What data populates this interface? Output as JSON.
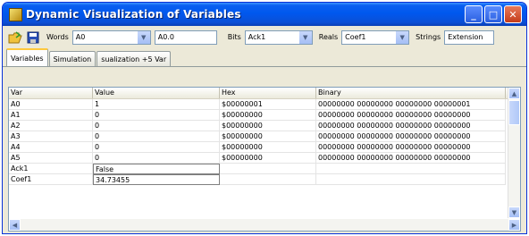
{
  "window": {
    "title": "Dynamic Visualization of Variables"
  },
  "toolbar": {
    "words_label": "Words",
    "words_value": "A0",
    "words_field": "A0.0",
    "bits_label": "Bits",
    "bits_value": "Ack1",
    "reals_label": "Reals",
    "reals_value": "Coef1",
    "strings_label": "Strings",
    "strings_value": "Extension"
  },
  "tabs": [
    {
      "label": "Variables"
    },
    {
      "label": "Simulation"
    },
    {
      "label": "sualization +5 Var"
    }
  ],
  "table": {
    "headers": [
      "Var",
      "Value",
      "Hex",
      "Binary"
    ],
    "rows": [
      [
        "A0",
        "1",
        "$00000001",
        "00000000 00000000 00000000 00000001"
      ],
      [
        "A1",
        "0",
        "$00000000",
        "00000000 00000000 00000000 00000000"
      ],
      [
        "A2",
        "0",
        "$00000000",
        "00000000 00000000 00000000 00000000"
      ],
      [
        "A3",
        "0",
        "$00000000",
        "00000000 00000000 00000000 00000000"
      ],
      [
        "A4",
        "0",
        "$00000000",
        "00000000 00000000 00000000 00000000"
      ],
      [
        "A5",
        "0",
        "$00000000",
        "00000000 00000000 00000000 00000000"
      ],
      [
        "Ack1",
        "False",
        "",
        ""
      ],
      [
        "Coef1",
        "34.73455",
        "",
        ""
      ]
    ]
  }
}
